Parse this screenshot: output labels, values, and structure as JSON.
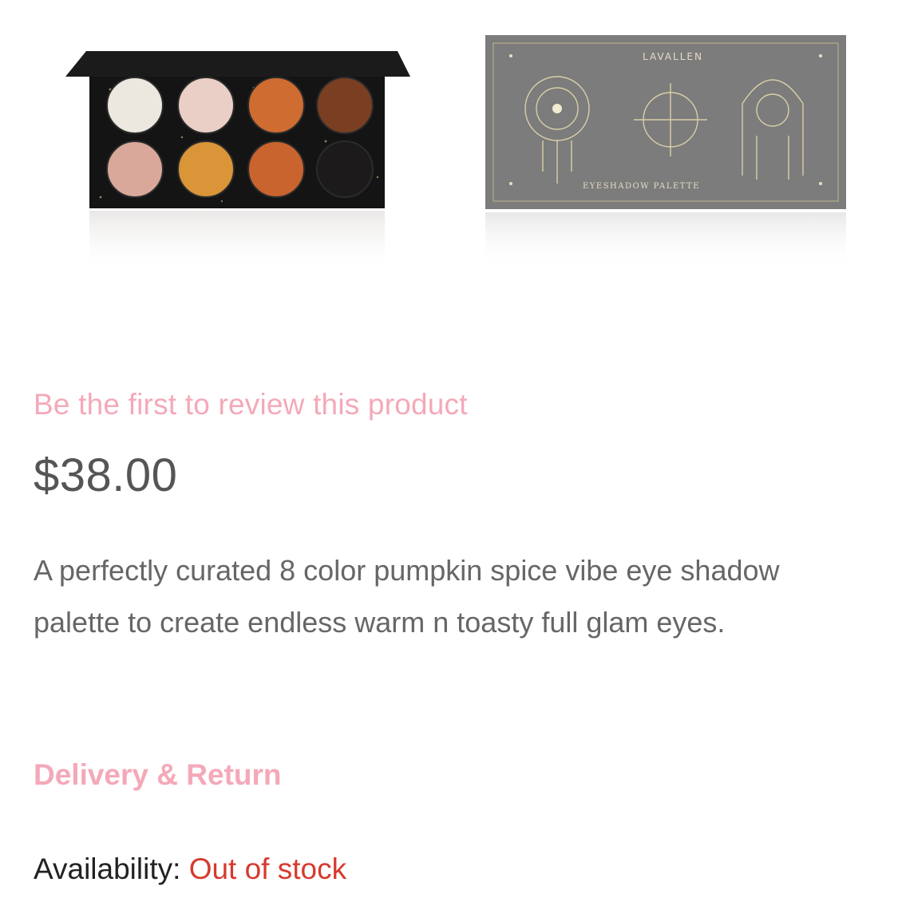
{
  "gallery": {
    "images": [
      {
        "name": "palette-open-image",
        "swatches": [
          "#ece7df",
          "#e9cfc6",
          "#cf6c31",
          "#7a3f22",
          "#d9a89a",
          "#d99538",
          "#c9642e",
          "#1c1a1a"
        ]
      },
      {
        "name": "palette-closed-image",
        "brand_text": "LAVALLEN",
        "label_text": "EYESHADOW PALETTE"
      }
    ]
  },
  "product": {
    "review_link": "Be the first to review this product",
    "price": "$38.00",
    "description": "A perfectly curated 8 color pumpkin spice vibe eye shadow palette to create endless warm n toasty full glam eyes.",
    "delivery_link": "Delivery & Return",
    "availability_label": "Availability:",
    "availability_value": "Out of stock"
  },
  "colors": {
    "accent_pink": "#f4a9b8",
    "out_of_stock_red": "#d63a2f",
    "price_gray": "#555555",
    "text_gray": "#666666"
  }
}
